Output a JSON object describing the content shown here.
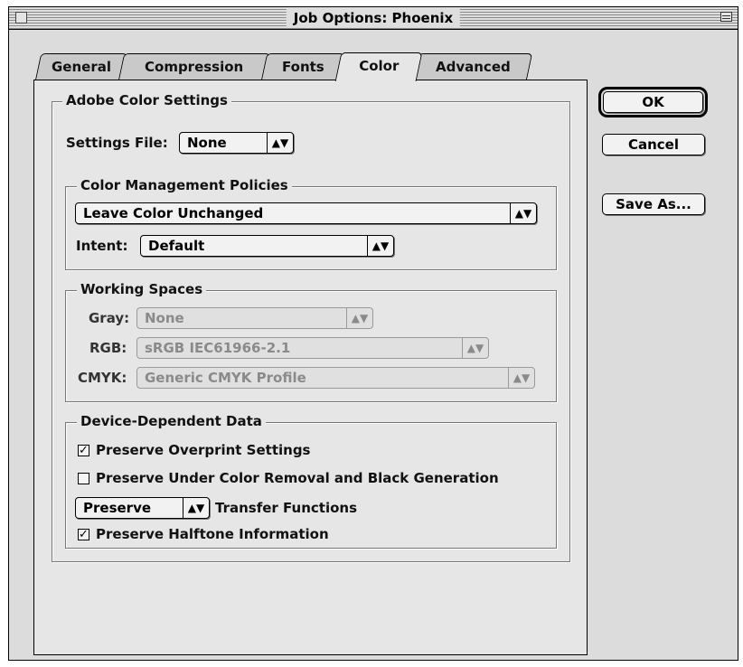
{
  "window": {
    "title": "Job Options: Phoenix"
  },
  "tabs": [
    {
      "label": "General"
    },
    {
      "label": "Compression"
    },
    {
      "label": "Fonts"
    },
    {
      "label": "Color",
      "active": true
    },
    {
      "label": "Advanced"
    }
  ],
  "buttons": {
    "ok": "OK",
    "cancel": "Cancel",
    "save_as": "Save As..."
  },
  "adobe_color": {
    "group_label": "Adobe Color Settings",
    "settings_file_label": "Settings File:",
    "settings_file_value": "None"
  },
  "color_management": {
    "group_label": "Color Management Policies",
    "policy_value": "Leave Color Unchanged",
    "intent_label": "Intent:",
    "intent_value": "Default"
  },
  "working_spaces": {
    "group_label": "Working Spaces",
    "gray_label": "Gray:",
    "gray_value": "None",
    "rgb_label": "RGB:",
    "rgb_value": "sRGB IEC61966-2.1",
    "cmyk_label": "CMYK:",
    "cmyk_value": "Generic CMYK Profile"
  },
  "device_data": {
    "group_label": "Device-Dependent Data",
    "preserve_overprint": {
      "label": "Preserve Overprint Settings",
      "checked": true
    },
    "preserve_ucr": {
      "label": "Preserve Under Color Removal and Black Generation",
      "checked": false
    },
    "transfer_value": "Preserve",
    "transfer_label": "Transfer Functions",
    "preserve_halftone": {
      "label": "Preserve Halftone Information",
      "checked": true
    }
  },
  "icons": {
    "popup_arrows": "up-down-arrow-icon",
    "check": "checkmark-icon"
  }
}
